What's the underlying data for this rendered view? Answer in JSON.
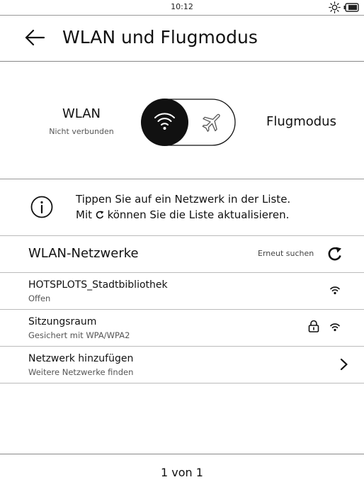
{
  "status_bar": {
    "time": "10:12",
    "icons": [
      "brightness-icon",
      "battery-icon"
    ]
  },
  "header": {
    "back_icon": "arrow-left-icon",
    "title": "WLAN und Flugmodus"
  },
  "mode_switch": {
    "wlan_label": "WLAN",
    "wlan_status": "Nicht verbunden",
    "airplane_label": "Flugmodus",
    "active": "wlan",
    "icons": [
      "wifi-icon",
      "airplane-icon"
    ]
  },
  "info": {
    "icon": "info-icon",
    "line1": "Tippen Sie auf ein Netzwerk in der Liste.",
    "line2_before": "Mit",
    "line2_icon": "refresh-icon",
    "line2_after": "können Sie die Liste aktualisieren."
  },
  "networks_section": {
    "title": "WLAN-Netzwerke",
    "rescan_label": "Erneut suchen",
    "rescan_icon": "refresh-icon"
  },
  "networks": [
    {
      "name": "HOTSPLOTS_Stadtbibliothek",
      "security": "Offen",
      "locked": false
    },
    {
      "name": "Sitzungsraum",
      "security": "Gesichert mit WPA/WPA2",
      "locked": true
    }
  ],
  "add_network": {
    "label": "Netzwerk hinzufügen",
    "sublabel": "Weitere Netzwerke finden",
    "icon": "chevron-right-icon"
  },
  "footer": {
    "pager": "1 von 1"
  },
  "colors": {
    "text": "#111111",
    "secondary": "#555555",
    "divider": "#bbbbbb",
    "toggle_active": "#111111"
  }
}
